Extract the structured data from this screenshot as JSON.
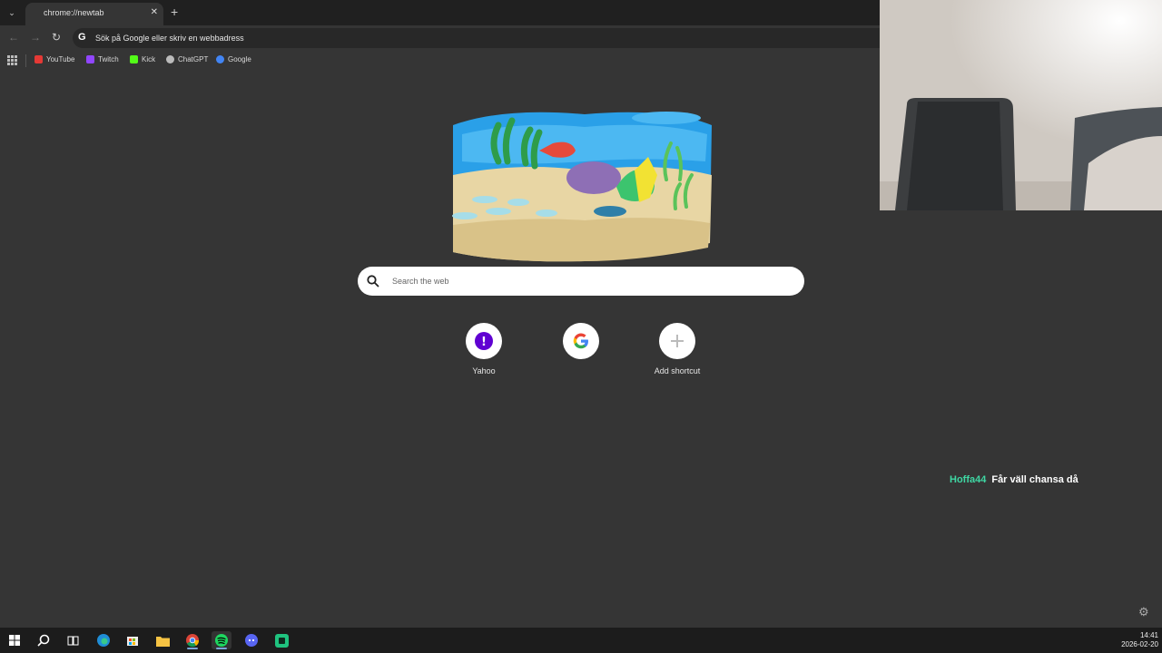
{
  "browser": {
    "tab": {
      "title": "chrome://newtab",
      "close": "✕"
    },
    "new_tab": "+",
    "omnibox": {
      "text": "Sök på Google eller skriv en webbadress"
    },
    "bookmarks": [
      {
        "label": "YouTube",
        "color": "#e53935"
      },
      {
        "label": "Twitch",
        "color": "#9146ff"
      },
      {
        "label": "Kick",
        "color": "#53fc18"
      },
      {
        "label": "ChatGPT",
        "color": "#bbbbbb"
      },
      {
        "label": "Google",
        "color": "#4285f4"
      }
    ]
  },
  "newtab": {
    "search_placeholder": "Search the web",
    "shortcuts": [
      {
        "label": "Yahoo",
        "icon": "yahoo-icon"
      },
      {
        "label": "",
        "icon": "google-icon"
      },
      {
        "label": "Add shortcut",
        "icon": "plus-icon"
      }
    ]
  },
  "chat": {
    "user": "Hoffa44",
    "message": "Får väll chansa då",
    "user_color": "#3fd8a4"
  },
  "taskbar": {
    "time": "14:41",
    "date": "2026-02-20",
    "apps": [
      "start-icon",
      "search-icon",
      "task-view-icon",
      "edge-icon",
      "store-icon",
      "file-explorer-icon",
      "chrome-icon",
      "spotify-icon",
      "discord-icon",
      "app-icon"
    ]
  }
}
